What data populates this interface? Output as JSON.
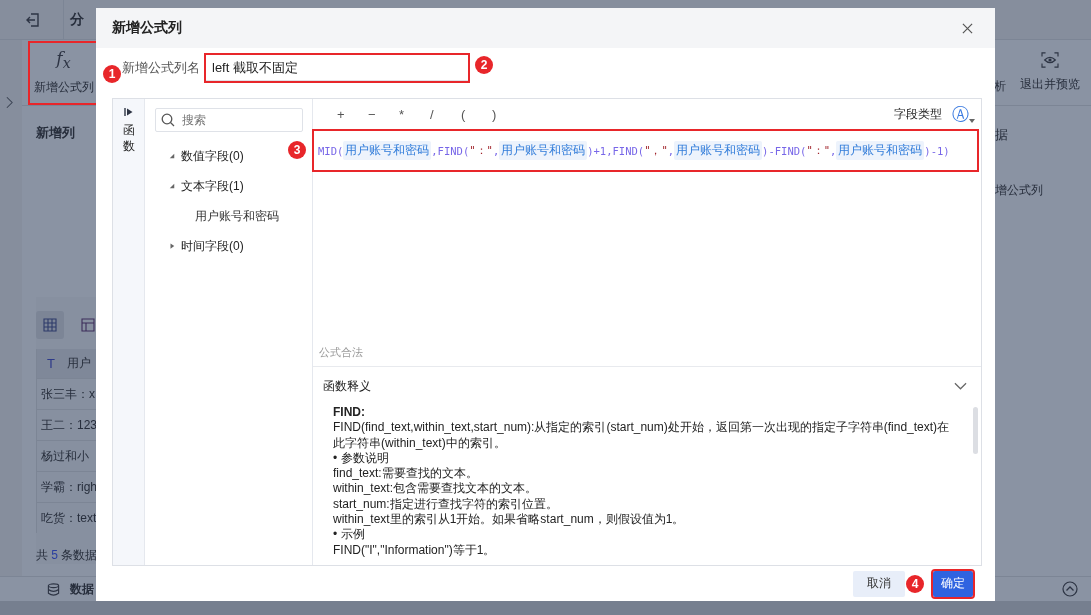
{
  "background": {
    "top_bar": {
      "tab": "分"
    },
    "toolbar": {
      "buttons": [
        {
          "icon": "f$_{x}$",
          "label": "新增公式列",
          "callout": "1"
        }
      ],
      "right_buttons": [
        {
          "label": "析"
        },
        {
          "label": "退出并预览"
        }
      ]
    },
    "left_panel": {
      "title": "新增列"
    },
    "right_panel": {
      "items": [
        "据",
        "增公式列"
      ]
    },
    "table": {
      "type_icon": "T",
      "header": "用户",
      "rows": [
        "张三丰：x",
        "王二：123",
        "杨过和小",
        "学霸：righ",
        "吃货：text"
      ]
    },
    "count": {
      "prefix": "共",
      "value": "5",
      "suffix": "条数据"
    },
    "bottom_tab": "数据"
  },
  "modal": {
    "title": "新增公式列",
    "name_label": "新增公式列名",
    "name_value": "left 截取不固定",
    "name_callout": "2",
    "side_tab": {
      "label": "函数"
    },
    "search": {
      "placeholder": "搜索"
    },
    "tree": [
      {
        "label": "数值字段(0)",
        "expanded": true
      },
      {
        "label": "文本字段(1)",
        "expanded": true,
        "children": [
          {
            "label": "用户账号和密码"
          }
        ]
      },
      {
        "label": "时间字段(0)",
        "expanded": false
      }
    ],
    "operators": [
      "+",
      "−",
      "*",
      "/",
      "(",
      ")"
    ],
    "field_type": {
      "label": "字段类型",
      "icon": "Ⓐ"
    },
    "formula": {
      "callout": "3",
      "tokens": [
        {
          "kind": "fn",
          "text": "MID("
        },
        {
          "kind": "field",
          "text": "用户账号和密码"
        },
        {
          "kind": "fn",
          "text": ",FIND("
        },
        {
          "kind": "str",
          "text": "\"：\""
        },
        {
          "kind": "fn",
          "text": ","
        },
        {
          "kind": "field",
          "text": "用户账号和密码"
        },
        {
          "kind": "fn",
          "text": ")+1,FIND("
        },
        {
          "kind": "str",
          "text": "\"，\""
        },
        {
          "kind": "fn",
          "text": ","
        },
        {
          "kind": "field",
          "text": "用户账号和密码"
        },
        {
          "kind": "fn",
          "text": ")-FIND("
        },
        {
          "kind": "str",
          "text": "\"：\""
        },
        {
          "kind": "fn",
          "text": ","
        },
        {
          "kind": "field",
          "text": "用户账号和密码"
        },
        {
          "kind": "fn",
          "text": ")-1)"
        }
      ]
    },
    "status": "公式合法",
    "doc": {
      "title": "函数释义",
      "expanded": true,
      "heading": "FIND:",
      "lines": [
        "FIND(find_text,within_text,start_num):从指定的索引(start_num)处开始，返回第一次出现的指定子字符串(find_text)在此字符串(within_text)中的索引。",
        "• 参数说明",
        "find_text:需要查找的文本。",
        "within_text:包含需要查找文本的文本。",
        "start_num:指定进行查找字符的索引位置。",
        "within_text里的索引从1开始。如果省略start_num，则假设值为1。",
        "• 示例",
        "FIND(\"I\",\"Information\")等于1。"
      ]
    },
    "buttons": [
      {
        "label": "取消",
        "kind": "secondary"
      },
      {
        "label": "确定",
        "kind": "primary",
        "callout": "4"
      }
    ]
  }
}
